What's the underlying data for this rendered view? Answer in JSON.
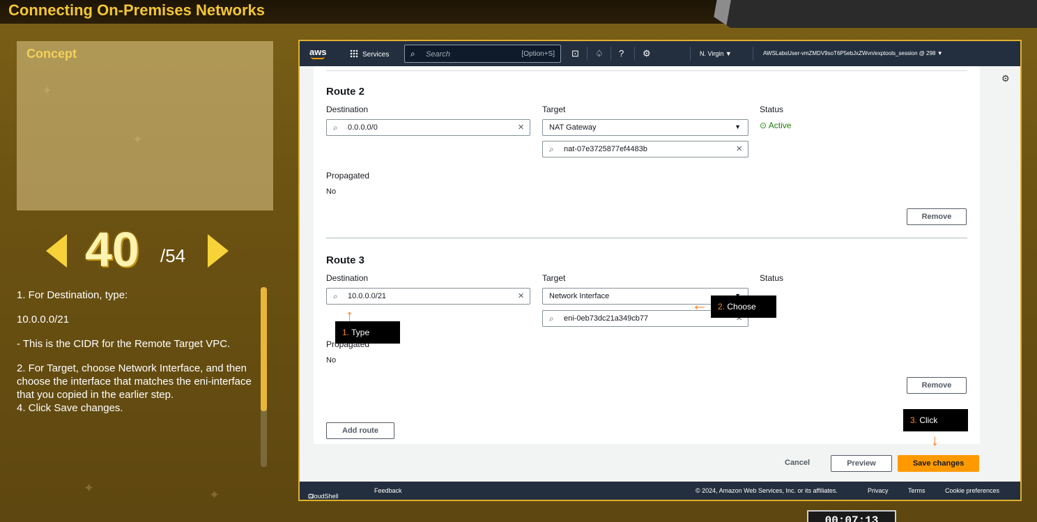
{
  "banner": {
    "title": "Connecting On-Premises Networks"
  },
  "left": {
    "concept_label": "Concept",
    "page_current": "40",
    "page_total": "/54",
    "instructions": [
      "1. For Destination, type:",
      "10.0.0.0/21",
      "- This is the CIDR for the Remote Target VPC.",
      "2. For Target, choose Network Interface, and then choose the interface that matches the eni-interface that you copied in the earlier step.",
      "4. Click Save changes."
    ]
  },
  "topnav": {
    "logo": "aws",
    "services": "Services",
    "search_placeholder": "Search",
    "search_shortcut": "[Option+S]",
    "region": "N. Virgin",
    "account": "AWSLabsUser-vmZMDV9soT6P5ebJxZWvn/exptools_session @ 298"
  },
  "icons": {
    "cloudshell": "terminal-icon",
    "notifications": "bell-icon",
    "help": "help-icon",
    "settings": "gear-icon",
    "search": "search-icon"
  },
  "route2": {
    "title": "Route 2",
    "destination_label": "Destination",
    "destination_value": "0.0.0.0/0",
    "target_label": "Target",
    "target_value": "NAT Gateway",
    "target_sub_value": "nat-07e3725877ef4483b",
    "status_label": "Status",
    "status_value": "Active",
    "propagated_label": "Propagated",
    "propagated_value": "No",
    "remove": "Remove"
  },
  "route3": {
    "title": "Route 3",
    "destination_label": "Destination",
    "destination_value": "10.0.0.0/21",
    "target_label": "Target",
    "target_value": "Network Interface",
    "target_sub_value": "eni-0eb73dc21a349cb77",
    "status_label": "Status",
    "propagated_label": "Propagated",
    "propagated_value": "No",
    "remove": "Remove"
  },
  "actions": {
    "add_route": "Add route",
    "cancel": "Cancel",
    "preview": "Preview",
    "save": "Save changes"
  },
  "footer": {
    "cloudshell": "CloudShell",
    "feedback": "Feedback",
    "copyright": "© 2024, Amazon Web Services, Inc. or its affiliates.",
    "privacy": "Privacy",
    "terms": "Terms",
    "cookies": "Cookie preferences"
  },
  "callouts": {
    "type": {
      "num": "1.",
      "text": " Type"
    },
    "choose": {
      "num": "2.",
      "text": " Choose"
    },
    "click": {
      "num": "3.",
      "text": " Click"
    }
  },
  "timer": "00:07:13",
  "colors": {
    "accent": "#ff9900",
    "banner_text": "#f3c637",
    "active": "#1d8102"
  }
}
